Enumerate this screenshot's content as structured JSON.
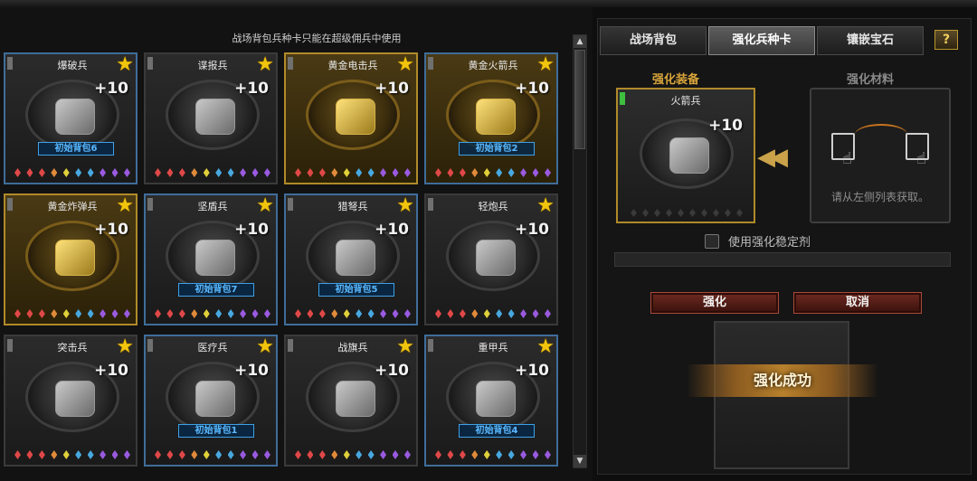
{
  "notice": "战场背包兵种卡只能在超级佣兵中使用",
  "gem_colors": [
    "#e04848",
    "#e04848",
    "#e04848",
    "#e08a3a",
    "#e0d03a",
    "#48a8e0",
    "#48a8e0",
    "#9a5ae0",
    "#9a5ae0",
    "#9a5ae0"
  ],
  "cards": [
    {
      "title": "爆破兵",
      "level": "+10",
      "bag": "初始背包6",
      "gold": false
    },
    {
      "title": "谍报兵",
      "level": "+10",
      "bag": "",
      "gold": false
    },
    {
      "title": "黄金电击兵",
      "level": "+10",
      "bag": "",
      "gold": true
    },
    {
      "title": "黄金火箭兵",
      "level": "+10",
      "bag": "初始背包2",
      "gold": true
    },
    {
      "title": "黄金炸弹兵",
      "level": "+10",
      "bag": "",
      "gold": true
    },
    {
      "title": "坚盾兵",
      "level": "+10",
      "bag": "初始背包7",
      "gold": false
    },
    {
      "title": "猎弩兵",
      "level": "+10",
      "bag": "初始背包5",
      "gold": false
    },
    {
      "title": "轻炮兵",
      "level": "+10",
      "bag": "",
      "gold": false
    },
    {
      "title": "突击兵",
      "level": "+10",
      "bag": "",
      "gold": false
    },
    {
      "title": "医疗兵",
      "level": "+10",
      "bag": "初始背包1",
      "gold": false
    },
    {
      "title": "战旗兵",
      "level": "+10",
      "bag": "",
      "gold": false
    },
    {
      "title": "重甲兵",
      "level": "+10",
      "bag": "初始背包4",
      "gold": false
    }
  ],
  "tabs": [
    {
      "label": "战场背包",
      "active": false
    },
    {
      "label": "强化兵种卡",
      "active": true
    },
    {
      "label": "镶嵌宝石",
      "active": false
    }
  ],
  "help_label": "?",
  "enhance": {
    "equip_title": "强化装备",
    "material_title": "强化材料",
    "equip_card": {
      "title": "火箭兵",
      "level": "+10"
    },
    "material_hint": "请从左侧列表获取。",
    "stabilizer_label": "使用强化稳定剂",
    "enhance_button": "强化",
    "cancel_button": "取消",
    "result_text": "强化成功"
  },
  "scrollbar": {
    "up_icon": "scroll-up-arrow",
    "down_icon": "scroll-down-arrow"
  }
}
